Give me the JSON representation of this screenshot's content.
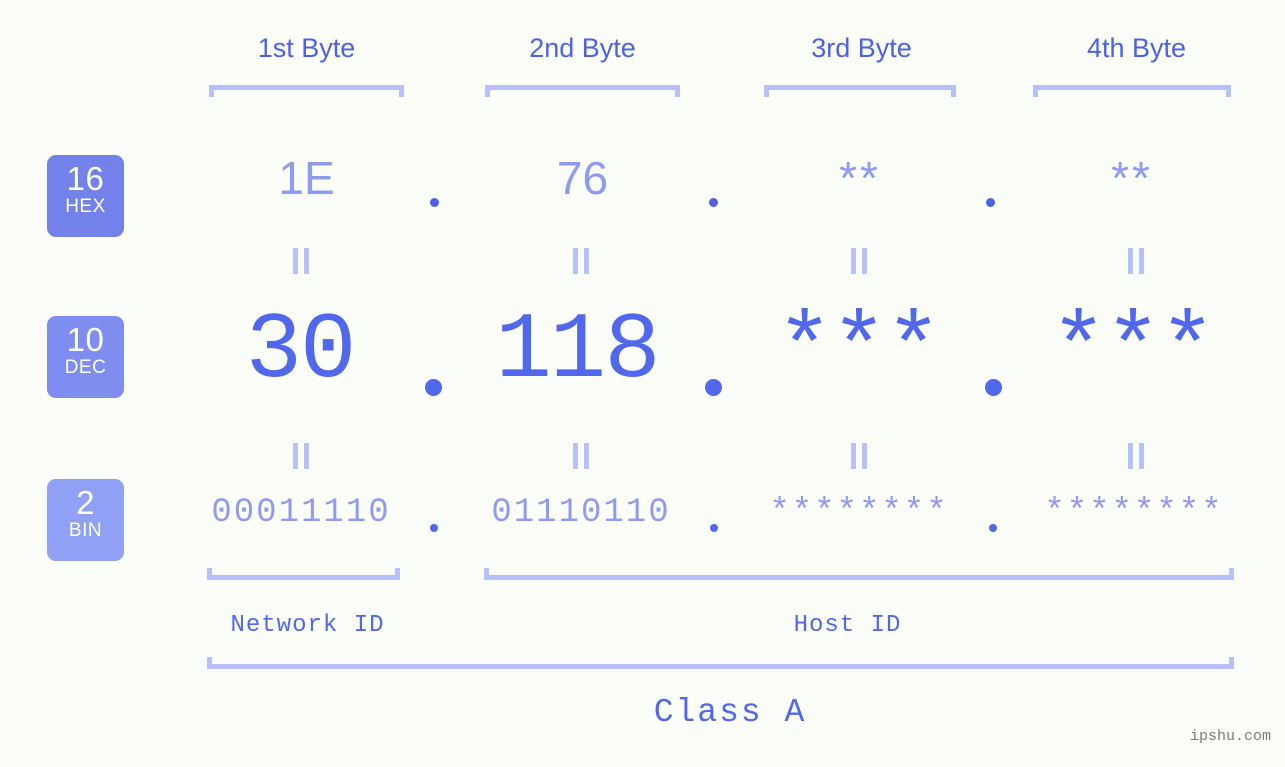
{
  "page": {
    "background_color": "#fbfdf8",
    "accent_color": "#5268ec",
    "light_accent_color": "#b7c0fb",
    "muted_value_color": "#8e9bf2"
  },
  "headers": {
    "bytes": [
      {
        "label": "1st Byte"
      },
      {
        "label": "2nd Byte"
      },
      {
        "label": "3rd Byte"
      },
      {
        "label": "4th Byte"
      }
    ]
  },
  "bases": [
    {
      "number": "16",
      "name": "HEX",
      "color": "#7382ea"
    },
    {
      "number": "10",
      "name": "DEC",
      "color": "#7f8df0"
    },
    {
      "number": "2",
      "name": "BIN",
      "color": "#8fa0f5"
    }
  ],
  "rows": {
    "hex": {
      "values": [
        "1E",
        "76",
        "**",
        "**"
      ],
      "separators": [
        ".",
        ".",
        "."
      ]
    },
    "dec": {
      "values": [
        "30",
        "118",
        "***",
        "***"
      ],
      "separators": [
        ".",
        ".",
        "."
      ]
    },
    "bin": {
      "values": [
        "00011110",
        "01110110",
        "********",
        "********"
      ],
      "separators": [
        ".",
        ".",
        "."
      ]
    }
  },
  "equality_marks": {
    "symbol": "=",
    "count_per_row": 4
  },
  "footer": {
    "network_id_label": "Network ID",
    "host_id_label": "Host ID",
    "class_label": "Class A"
  },
  "watermark": {
    "text": "ipshu.com"
  }
}
